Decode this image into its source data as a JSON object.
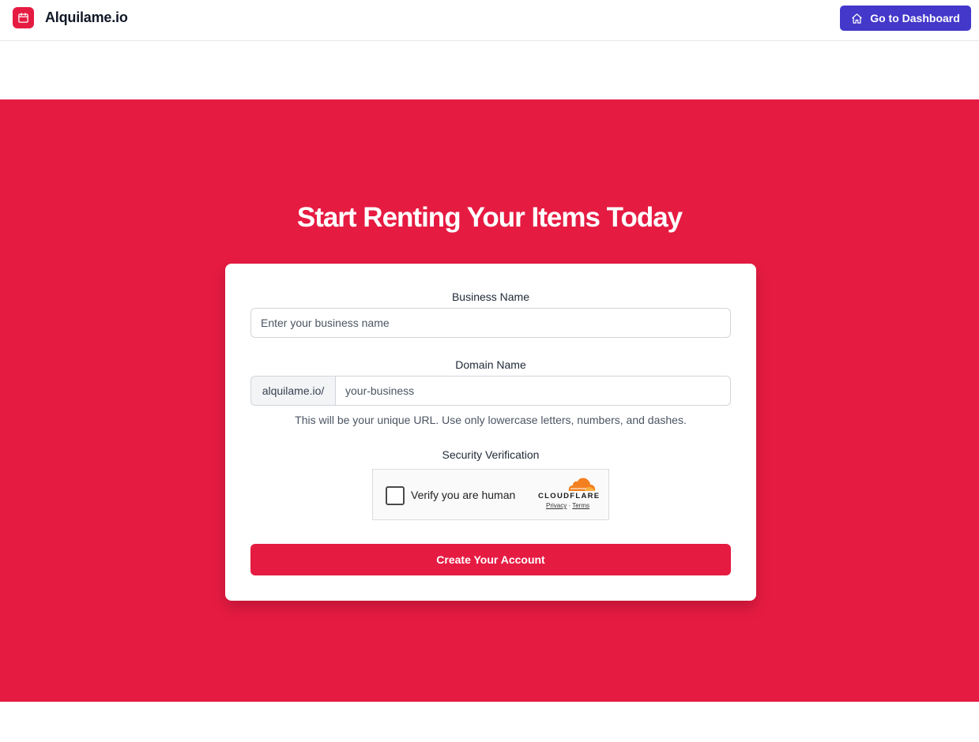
{
  "header": {
    "brand_name": "Alquilame.io",
    "brand_icon": "calendar-icon",
    "dashboard_button_label": "Go to Dashboard",
    "dashboard_icon": "home-icon"
  },
  "hero": {
    "title": "Start Renting Your Items Today"
  },
  "form": {
    "business_name": {
      "label": "Business Name",
      "placeholder": "Enter your business name",
      "value": ""
    },
    "domain_name": {
      "label": "Domain Name",
      "prefix": "alquilame.io/",
      "placeholder": "your-business",
      "value": "",
      "helper": "This will be your unique URL. Use only lowercase letters, numbers, and dashes."
    },
    "security": {
      "label": "Security Verification",
      "checkbox_label": "Verify you are human",
      "provider": "CLOUDFLARE",
      "privacy_link": "Privacy",
      "separator": "·",
      "terms_link": "Terms",
      "checked": false
    },
    "submit_label": "Create Your Account"
  },
  "colors": {
    "brand": "#e61b42",
    "dashboard_button": "#4338ca",
    "cloudflare_orange": "#f38020"
  }
}
